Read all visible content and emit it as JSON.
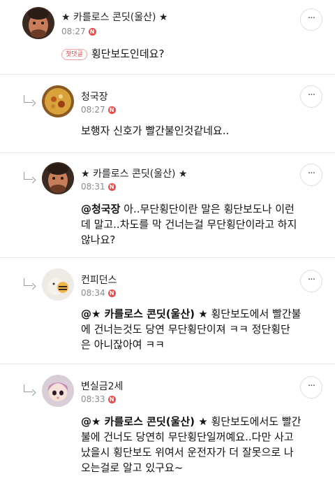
{
  "comments": [
    {
      "author": "★ 카를로스 콘딧(울산) ★",
      "time": "08:27",
      "badge": "N",
      "first_comment_label": "첫댓글",
      "body_lines": [
        "횡단보도인데요?"
      ],
      "more": "···"
    },
    {
      "author": "청국장",
      "time": "08:27",
      "badge": "N",
      "body_lines": [
        "보행자 신호가 빨간불인것같네요.."
      ],
      "more": "···"
    },
    {
      "author": "★ 카를로스 콘딧(울산) ★",
      "time": "08:31",
      "badge": "N",
      "mention": "@청국장",
      "body_lines": [
        "아..무단횡단이란 말은 횡단보도나 이런",
        "데 말고..차도를 막 건너는걸 무단횡단이라고 하지",
        "않나요?"
      ],
      "more": "···"
    },
    {
      "author": "컨피던스",
      "time": "08:34",
      "badge": "N",
      "mention": "@★ 카를로스 콘딧(울산) ★",
      "body_lines": [
        "횡단보도에서 빨간불",
        "에 건너는것도 당연 무단횡단이져 ㅋㅋ 정단횡단",
        "은 아니잖아여 ㅋㅋ"
      ],
      "more": "···"
    },
    {
      "author": "변실금2세",
      "time": "08:33",
      "badge": "N",
      "mention": "@★ 카를로스 콘딧(울산) ★",
      "body_lines": [
        "횡단보도에서도 빨간",
        "불에 건너도 당연히 무단횡단일꺼예요..다만 사고",
        "났을시 횡단보도 위여서 운전자가 더 잘못으로 나",
        "오는걸로 알고 있구요~"
      ],
      "more": "···"
    }
  ]
}
